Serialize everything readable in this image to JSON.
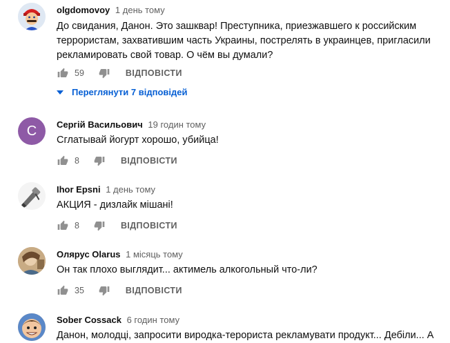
{
  "colors": {
    "author_text": "#0f0f0f",
    "meta_text": "#606060",
    "link_blue": "#065fd4",
    "avatar_purple": "#8e5aa6"
  },
  "comments": [
    {
      "author": "olgdomovoy",
      "time": "1 день тому",
      "text_lines": [
        "До свидания, Данон. Это зашквар! Преступника, приезжавшего к российским",
        "террористам, захватившим часть Украины, пострелять в украинцев,  пригласили",
        "рекламировать свой товар. О чём вы думали?"
      ],
      "likes": "59",
      "reply_label": "ВІДПОВІСТИ",
      "view_replies_label": "Переглянути 7 відповідей",
      "avatar_icon": "mario-avatar-icon"
    },
    {
      "author": "Сергій Васильович",
      "time": "19 годин тому",
      "text_lines": [
        "Сглатывай йогурт хорошо, убийца!"
      ],
      "likes": "8",
      "reply_label": "ВІДПОВІСТИ",
      "avatar_letter": "C",
      "avatar_icon": "letter-avatar-icon"
    },
    {
      "author": "Ihor Epsni",
      "time": "1 день тому",
      "text_lines": [
        "АКЦИЯ - дизлайк мішані!"
      ],
      "likes": "8",
      "reply_label": "ВІДПОВІСТИ",
      "avatar_icon": "dental-drill-avatar-icon"
    },
    {
      "author": "Олярус Olarus",
      "time": "1 місяць тому",
      "text_lines": [
        "Он так плохо выглядит... актимель алкогольный что-ли?"
      ],
      "likes": "35",
      "reply_label": "ВІДПОВІСТИ",
      "avatar_icon": "photo-avatar-icon"
    },
    {
      "author": "Sober Cossack",
      "time": "6 годин тому",
      "text_lines": [
        "Данон, молодці, запросити виродка-терориста рекламувати продукт... Дебіли... А"
      ],
      "avatar_icon": "cartoon-face-avatar-icon"
    }
  ]
}
